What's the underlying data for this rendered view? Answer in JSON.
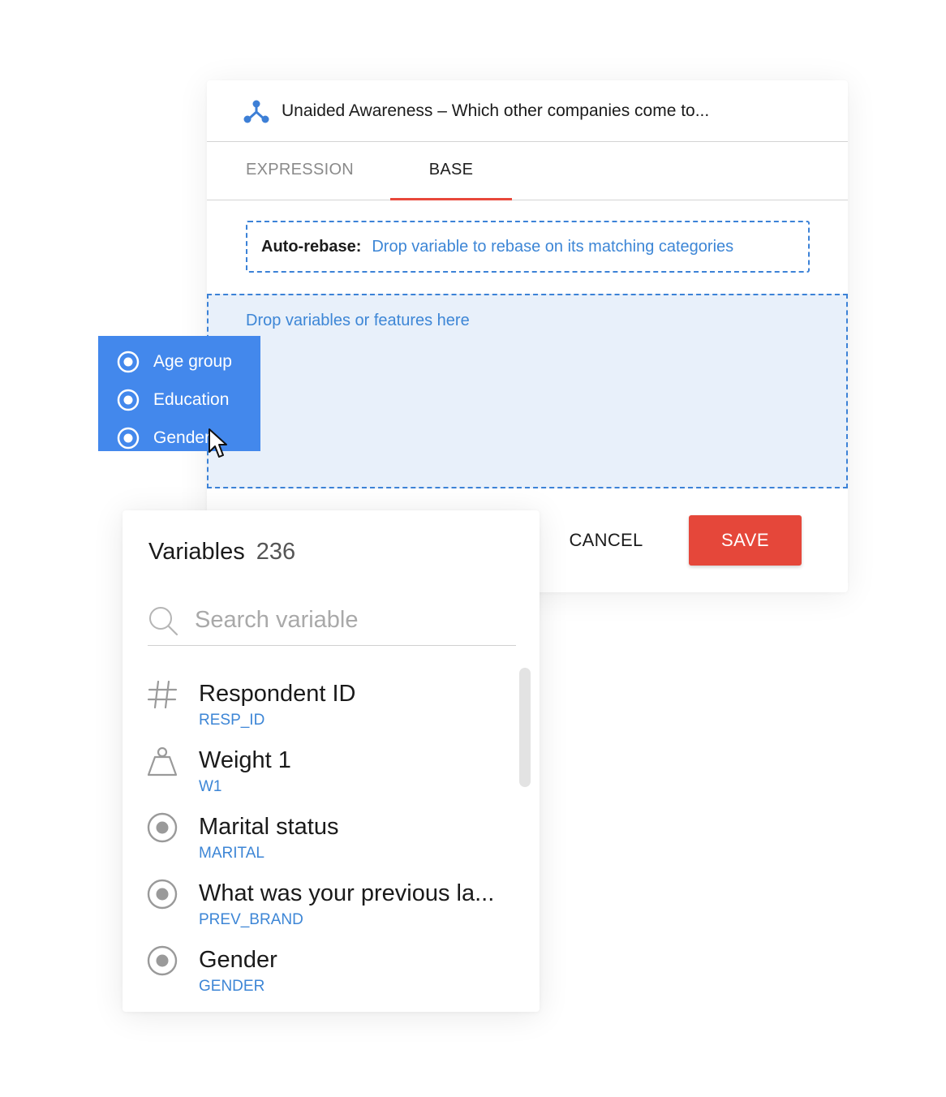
{
  "dialog": {
    "title": "Unaided Awareness – Which other companies come to...",
    "title_icon": "network-nodes-icon",
    "tabs": [
      {
        "label": "EXPRESSION",
        "active": false
      },
      {
        "label": "BASE",
        "active": true
      }
    ],
    "auto_rebase": {
      "label": "Auto-rebase:",
      "message": "Drop variable to rebase on its matching categories"
    },
    "dropzone_message": "Drop variables or features here",
    "cancel_label": "CANCEL",
    "save_label": "SAVE"
  },
  "drag_chip": {
    "items": [
      {
        "label": "Age group",
        "icon": "radio-icon"
      },
      {
        "label": "Education",
        "icon": "radio-icon"
      },
      {
        "label": "Gender",
        "icon": "radio-icon"
      }
    ]
  },
  "variables": {
    "title": "Variables",
    "count": "236",
    "search_placeholder": "Search variable",
    "items": [
      {
        "name": "Respondent ID",
        "alias": "RESP_ID",
        "icon": "hash-icon"
      },
      {
        "name": "Weight 1",
        "alias": "W1",
        "icon": "weight-icon"
      },
      {
        "name": "Marital status",
        "alias": "MARITAL",
        "icon": "radio-icon"
      },
      {
        "name": "What was your previous la...",
        "alias": "PREV_BRAND",
        "icon": "radio-icon"
      },
      {
        "name": "Gender",
        "alias": "GENDER",
        "icon": "radio-icon"
      }
    ]
  },
  "colors": {
    "accent_blue": "#3d86d6",
    "chip_blue": "#4388ec",
    "save_red": "#e5473a",
    "tab_underline": "#e8483b",
    "dropzone_bg": "#e8f0fa"
  }
}
